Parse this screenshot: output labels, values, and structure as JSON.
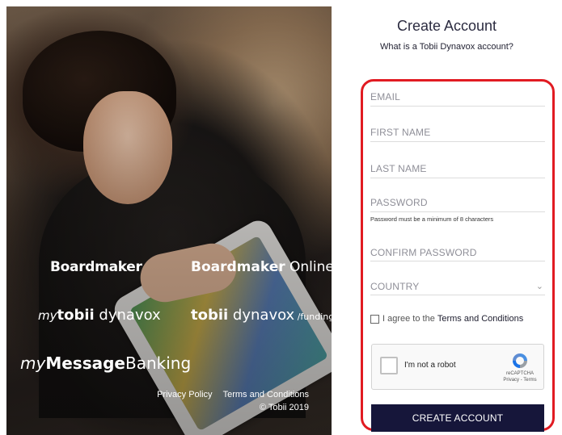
{
  "hero": {
    "logos": {
      "boardmaker": "Boardmaker",
      "boardmaker_online_prefix": "Boardmaker",
      "boardmaker_online_suffix": " Online",
      "my_tobii_my": "my",
      "my_tobii_brand": "tobii",
      "my_tobii_suffix": " dynavox",
      "tobii_brand": "tobii",
      "tobii_dynavox": " dynavox",
      "tobii_funding": " /funding",
      "msg_my": "my",
      "msg_message": "Message",
      "msg_banking": "Banking"
    },
    "links": {
      "privacy": "Privacy Policy",
      "terms": "Terms and Conditions",
      "copyright": "© Tobii 2019"
    }
  },
  "form": {
    "title": "Create Account",
    "subtitle": "What is a Tobii Dynavox account?",
    "fields": {
      "email": "EMAIL",
      "first_name": "FIRST NAME",
      "last_name": "LAST NAME",
      "password": "PASSWORD",
      "password_hint": "Password must be a minimum of 8 characters",
      "confirm_password": "CONFIRM PASSWORD",
      "country": "COUNTRY"
    },
    "agree_prefix": "I agree to the",
    "agree_link": "Terms and Conditions",
    "captcha": {
      "label": "I'm not a robot",
      "brand": "reCAPTCHA",
      "privacy_terms": "Privacy - Terms"
    },
    "submit_label": "CREATE ACCOUNT"
  },
  "colors": {
    "highlight_frame": "#e11b22",
    "button_bg": "#16163a"
  }
}
